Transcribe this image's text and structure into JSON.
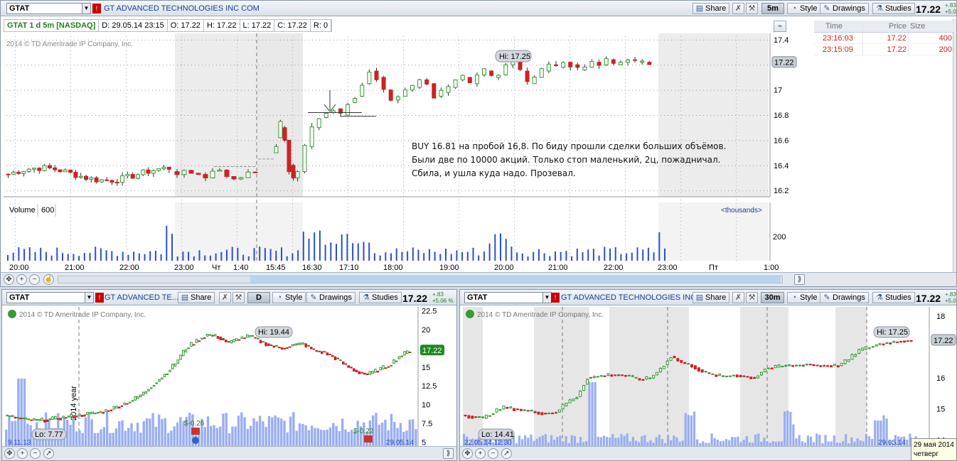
{
  "top": {
    "symbol": "GTAT",
    "company": "GT ADVANCED TECHNOLOGIES INC COM",
    "share": "Share",
    "aggregation": "5m",
    "style": "Style",
    "drawings": "Drawings",
    "studies": "Studies",
    "last": "17.22",
    "change_top": "+.83",
    "change_bottom": "+5.0",
    "info": [
      "GTAT 1 d 5m [NASDAQ]",
      "D: 29.05.14 23:15",
      "O: 17.22",
      "H: 17.22",
      "L: 17.22",
      "C: 17.22",
      "R: 0"
    ],
    "copyright": "2014 © TD Ameritrade IP Company, Inc.",
    "hi_label": "Hi: 17.25",
    "price_ticks": [
      "17.4",
      "17.22",
      "17",
      "16.8",
      "16.6",
      "16.4",
      "16.2"
    ],
    "volume_label": "Volume",
    "volume_value": "600",
    "volume_units": "<thousands>",
    "volume_tick": "200",
    "time_ticks": [
      "20:00",
      "21:00",
      "22:00",
      "23:00",
      "Чт",
      "1:40",
      "15:45",
      "16:30",
      "17:10",
      "18:00",
      "19:00",
      "20:00",
      "21:00",
      "22:00",
      "23:00",
      "Пт",
      "1:00"
    ],
    "note_lines": [
      "BUY 16.81 на пробой 16,8. По биду прошли сделки больших объёмов.",
      "Были две по 10000 акций. Только стоп маленький, 2ц, пожадничал.",
      "Сбила, и ушла куда надо. Прозевал."
    ]
  },
  "time_sales": {
    "headers": [
      "Time",
      "Price",
      "Size"
    ],
    "rows": [
      {
        "time": "23:16:03",
        "price": "17.22",
        "size": "400"
      },
      {
        "time": "23:15:09",
        "price": "17.22",
        "size": "200"
      }
    ]
  },
  "bottom_left": {
    "symbol": "GTAT",
    "company": "GT ADVANCED TE...",
    "share": "Share",
    "aggregation": "D",
    "style": "Style",
    "drawings": "Drawings",
    "studies": "Studies",
    "last": "17.22",
    "change_top": "+.83",
    "change_bottom": "+5.06 %",
    "copyright": "2014 © TD Ameritrade IP Company, Inc.",
    "hi_label": "Hi: 19.44",
    "lo_label": "Lo: 7.77",
    "year_label": "2014 year",
    "div1": "$-0.26",
    "div2": "$-0.22",
    "date_left": "9.11.13",
    "date_right": "29.05.14",
    "price_ticks": [
      "22.5",
      "20",
      "17.22",
      "15",
      "12.5",
      "10",
      "7.5",
      "5"
    ]
  },
  "bottom_right": {
    "symbol": "GTAT",
    "company": "GT ADVANCED TECHNOLOGIES INC...",
    "share": "Share",
    "aggregation": "30m",
    "style": "Style",
    "drawings": "Drawings",
    "studies": "Studies",
    "last": "17.22",
    "change_top": "+.83",
    "change_bottom": "+5.0",
    "copyright": "2014 © TD Ameritrade IP Company, Inc.",
    "hi_label": "Hi: 17.25",
    "lo_label": "Lo: 14.41",
    "date_left": "22.05.14 12:30",
    "date_right": "29.05.14",
    "price_ticks": [
      "18",
      "17.22",
      "16",
      "15",
      "14"
    ]
  },
  "tooltip": {
    "date": "29 мая 2014",
    "weekday": "четверг"
  },
  "colors": {
    "up": "#2f9a2f",
    "down": "#cc2222",
    "volume": "#2a4fd0",
    "last_badge": "#1e8a1e"
  }
}
